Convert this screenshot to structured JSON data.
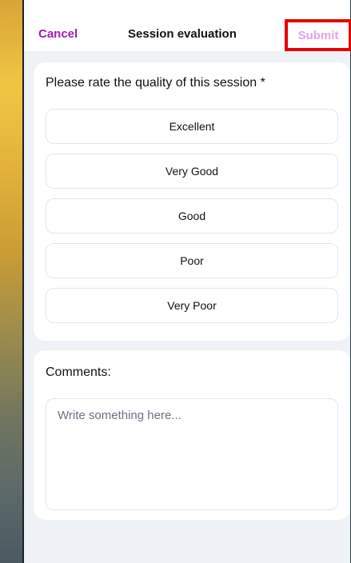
{
  "header": {
    "cancel_label": "Cancel",
    "title": "Session evaluation",
    "submit_label": "Submit"
  },
  "rating": {
    "question": "Please rate the quality of this session *",
    "options": [
      {
        "label": "Excellent"
      },
      {
        "label": "Very Good"
      },
      {
        "label": "Good"
      },
      {
        "label": "Poor"
      },
      {
        "label": "Very Poor"
      }
    ]
  },
  "comments": {
    "label": "Comments:",
    "value": "",
    "placeholder": "Write something here..."
  },
  "colors": {
    "accent": "#a21caf",
    "submit_disabled": "#e6a1ee",
    "highlight_box": "#e60000",
    "background": "#eef1f5"
  }
}
